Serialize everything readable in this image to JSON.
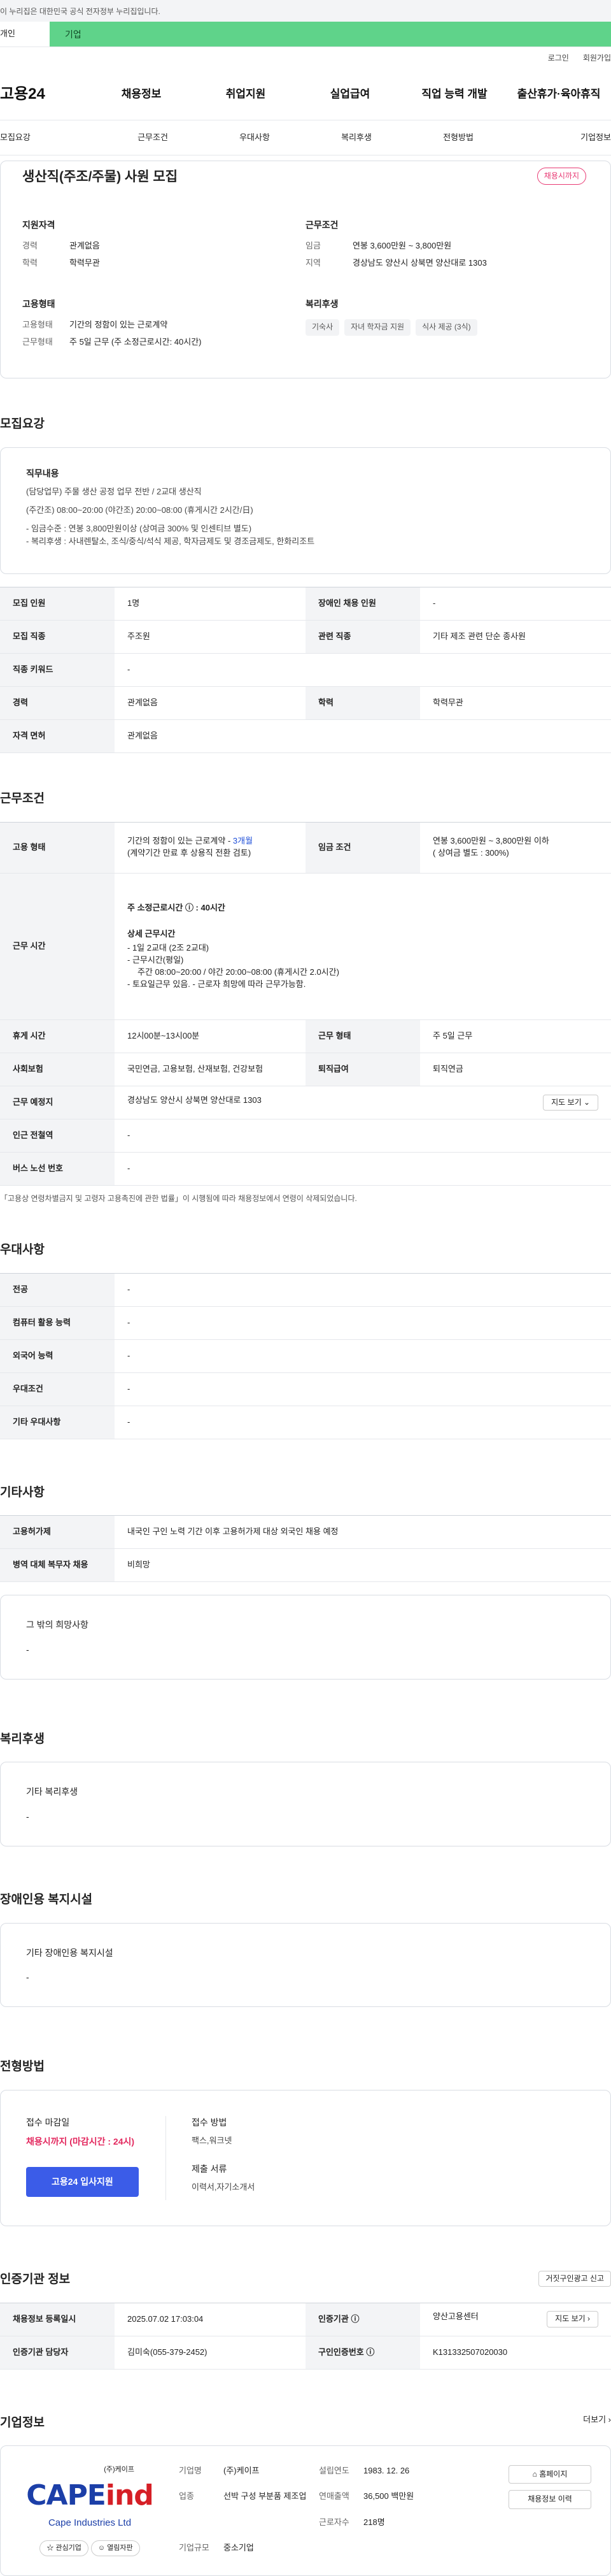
{
  "gov": {
    "text": "이 누리집은 대한민국 공식 전자정부 누리집입니다."
  },
  "tabs": {
    "individual": "개인",
    "corporate": "기업"
  },
  "util": {
    "login": "로그인",
    "signup": "회원가입"
  },
  "gnb": {
    "logo": "고용24",
    "items": [
      "채용정보",
      "취업지원",
      "실업급여",
      "직업 능력 개발",
      "출산휴가·육아휴직"
    ]
  },
  "subnav": [
    "모집요강",
    "근무조건",
    "우대사항",
    "복리후생",
    "전형방법",
    "기업정보"
  ],
  "summary": {
    "title": "생산직(주조/주물) 사원 모집",
    "close_badge": "채용시까지",
    "qual_title": "지원자격",
    "qual": [
      {
        "k": "경력",
        "v": "관계없음"
      },
      {
        "k": "학력",
        "v": "학력무관"
      }
    ],
    "cond_title": "근무조건",
    "cond": [
      {
        "k": "임금",
        "v": "연봉 3,600만원 ~ 3,800만원"
      },
      {
        "k": "지역",
        "v": "경상남도 양산시 상북면 양산대로 1303"
      }
    ],
    "emp_title": "고용형태",
    "emp": [
      {
        "k": "고용형태",
        "v": "기간의 정함이 있는 근로계약"
      },
      {
        "k": "근무형태",
        "v": "주 5일 근무 (주 소정근로시간: 40시간)"
      }
    ],
    "welfare_title": "복리후생",
    "welfare_chips": [
      "기숙사",
      "자녀 학자금 지원",
      "식사 제공 (3식)"
    ]
  },
  "recruit": {
    "title": "모집요강",
    "duty_head": "직무내용",
    "duty_lines": [
      "(담당업무) 주물 생산 공정 업무 전반 / 2교대 생산직",
      "(주간조) 08:00~20:00 (야간조) 20:00~08:00 (휴게시간 2시간/日)",
      "- 임금수준 : 연봉 3,800만원이상 (상여금 300% 및 인센티브 별도)",
      "- 복리후생 : 사내렌탈소, 조식/중식/석식 제공, 학자금제도 및 경조금제도, 한화리조트"
    ],
    "table": [
      {
        "k1": "모집 인원",
        "v1": "1명",
        "k2": "장애인 채용 인원",
        "v2": "-"
      },
      {
        "k1": "모집 직종",
        "v1": "주조원",
        "k2": "관련 직종",
        "v2": "기타 제조 관련 단순 종사원"
      },
      {
        "k1": "직종 키워드",
        "v1": "-",
        "k2": "",
        "v2": ""
      },
      {
        "k1": "경력",
        "v1": "관계없음",
        "k2": "학력",
        "v2": "학력무관"
      },
      {
        "k1": "자격 면허",
        "v1": "관계없음",
        "k2": "",
        "v2": ""
      }
    ]
  },
  "work": {
    "title": "근무조건",
    "emp_k": "고용 형태",
    "emp_v1": "기간의 정함이 있는 근로계약 - ",
    "emp_v1b": "3개월",
    "emp_v2": "(계약기간 만료 후 상용직 전환 검토)",
    "wage_k": "임금 조건",
    "wage_v1": "연봉 3,600만원 ~ 3,800만원 이하",
    "wage_v2": "( 상여금 별도 : 300%)",
    "hours_k": "근무 시간",
    "hours_lines": [
      "주 소정근로시간 ⓘ : 40시간",
      "상세 근무시간",
      "- 1일 2교대 (2조 2교대)",
      "- 근무시간(평일)",
      "  주간 08:00~20:00 / 야간 20:00~08:00 (휴게시간 2.0시간)",
      "- 토요일근무 있음. - 근로자 희망에 따라 근무가능함."
    ],
    "rows": [
      {
        "k1": "휴게 시간",
        "v1": "12시00분~13시00분",
        "k2": "근무 형태",
        "v2": "주 5일 근무"
      },
      {
        "k1": "사회보험",
        "v1": "국민연금, 고용보험, 산재보험, 건강보험",
        "k2": "퇴직급여",
        "v2": "퇴직연금"
      }
    ],
    "loc_k": "근무 예정지",
    "loc_v": "경상남도 양산시 상북면 양산대로 1303",
    "map_btn": "지도 보기 ⌄",
    "subway_k": "인근 전철역",
    "subway_v": "-",
    "bus_k": "버스 노선 번호",
    "bus_v": "-",
    "note": "「고용상 연령차별금지 및 고령자 고용촉진에 관한 법률」이 시행됨에 따라 채용정보에서 연령이 삭제되었습니다."
  },
  "pref": {
    "title": "우대사항",
    "rows": [
      {
        "k": "전공",
        "v": "-"
      },
      {
        "k": "컴퓨터 활용 능력",
        "v": "-"
      },
      {
        "k": "외국어 능력",
        "v": "-"
      },
      {
        "k": "우대조건",
        "v": "-"
      },
      {
        "k": "기타 우대사항",
        "v": "-"
      }
    ]
  },
  "etc": {
    "title": "기타사항",
    "rows": [
      {
        "k": "고용허가제",
        "v": "내국인 구인 노력 기간 이후 고용허가제 대상 외국인 채용 예정"
      },
      {
        "k": "병역 대체 복무자 채용",
        "v": "비희망"
      }
    ],
    "box_head": "그 밖의 희망사항",
    "box_val": "-"
  },
  "welfare": {
    "title": "복리후생",
    "head": "기타 복리후생",
    "val": "-"
  },
  "disab": {
    "title": "장애인용 복지시설",
    "head": "기타 장애인용 복지시설",
    "val": "-"
  },
  "process": {
    "title": "전형방법",
    "deadline_h": "접수 마감일",
    "deadline_v": "채용시까지 (마감시간 : 24시)",
    "apply_btn": "고용24 입사지원",
    "method_h": "접수 방법",
    "method_v": "팩스,워크넷",
    "docs_h": "제출 서류",
    "docs_v": "이력서,자기소개서"
  },
  "agency": {
    "title": "인증기관 정보",
    "report_btn": "거짓구인광고 신고",
    "rows": [
      {
        "k1": "채용정보 등록일시",
        "v1": "2025.07.02 17:03:04",
        "k2": "인증기관 ⓘ",
        "v2": "양산고용센터",
        "btn": "지도 보기 ›"
      },
      {
        "k1": "인증기관 담당자",
        "v1": "김미숙(055-379-2452)",
        "k2": "구인인증번호 ⓘ",
        "v2": "K131332507020030",
        "btn": ""
      }
    ]
  },
  "company": {
    "title": "기업정보",
    "more": "더보기 ›",
    "logo_top": "(주)케이프",
    "logo_big_a": "CAPE",
    "logo_big_b": "ind",
    "logo_sub": "Cape Industries Ltd",
    "btn_fav": "☆ 관심기업",
    "btn_review": "☺ 열림자판",
    "fields": [
      {
        "k": "기업명",
        "v": "(주)케이프"
      },
      {
        "k": "설립연도",
        "v": "1983. 12. 26"
      },
      {
        "k": "업종",
        "v": "선박 구성 부분품 제조업"
      },
      {
        "k": "연매출액",
        "v": "36,500 백만원"
      },
      {
        "k": "",
        "v": ""
      },
      {
        "k": "근로자수",
        "v": "218명"
      },
      {
        "k": "기업규모",
        "v": "중소기업"
      },
      {
        "k": "",
        "v": ""
      }
    ],
    "side": [
      "⌂ 홈페이지",
      "채용정보 이력"
    ]
  }
}
